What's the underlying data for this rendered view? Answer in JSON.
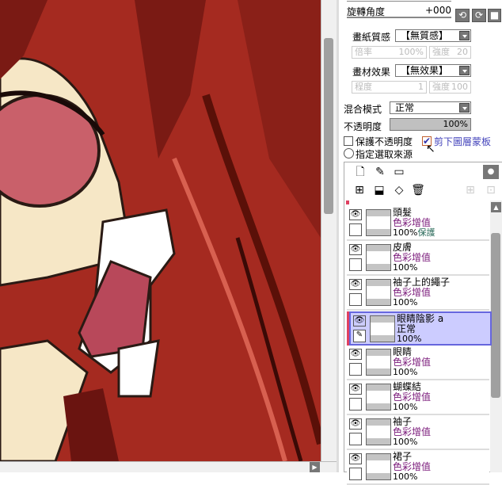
{
  "brush": {
    "rotation_label": "旋轉角度",
    "rotation_value": "+000"
  },
  "texture": {
    "paper_label": "畫紙質感",
    "paper_value": "【無質感】",
    "scale_label": "倍率",
    "scale_value": "100%",
    "strength_label": "強度",
    "strength_value": "20",
    "effect_label": "畫材效果",
    "effect_value": "【無效果】",
    "degree_label": "程度",
    "degree_value": "1",
    "effect_strength_label": "強度",
    "effect_strength_value": "100"
  },
  "layer_props": {
    "blend_label": "混合模式",
    "blend_value": "正常",
    "opacity_label": "不透明度",
    "opacity_value": "100%",
    "opacity": 100,
    "preserve_opacity": "保護不透明度",
    "clipping": "剪下圖層蒙板",
    "clipping_checked": true,
    "selection_source": "指定選取來源"
  },
  "layers": [
    {
      "name": "頭髮",
      "mode": "色彩增值",
      "opacity": "100%",
      "protect": "保護"
    },
    {
      "name": "皮膚",
      "mode": "色彩增值",
      "opacity": "100%"
    },
    {
      "name": "袖子上的繩子",
      "mode": "色彩增值",
      "opacity": "100%"
    },
    {
      "name": "眼睛陰影 a",
      "mode": "正常",
      "opacity": "100%",
      "active": true
    },
    {
      "name": "眼睛",
      "mode": "色彩增值",
      "opacity": "100%"
    },
    {
      "name": "蝴蝶結",
      "mode": "色彩增值",
      "opacity": "100%"
    },
    {
      "name": "袖子",
      "mode": "色彩增值",
      "opacity": "100%"
    },
    {
      "name": "裙子",
      "mode": "色彩增值",
      "opacity": "100%"
    }
  ]
}
